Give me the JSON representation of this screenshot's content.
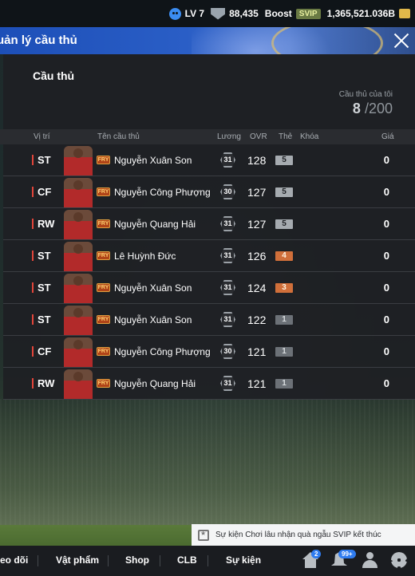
{
  "topbar": {
    "level": "LV 7",
    "points": "88,435",
    "boost_label": "Boost",
    "svip_label": "SVIP",
    "coins": "1,365,521.036B"
  },
  "titlebar": {
    "title": "uản lý cầu thủ"
  },
  "section_title": "Cầu thủ",
  "player_count": {
    "label": "Cầu thủ của tôi",
    "current": "8",
    "total": "/200"
  },
  "table": {
    "headers": {
      "position": "Vị trí",
      "name": "Tên cầu thủ",
      "wage": "Lương",
      "ovr": "OVR",
      "upgrade": "Thẻ",
      "lock": "Khóa",
      "price": "Giá"
    },
    "rows": [
      {
        "pos": "ST",
        "season": "FRY",
        "name": "Nguyễn Xuân Son",
        "wage": "31",
        "ovr": "128",
        "upgrade": "5",
        "price": "0"
      },
      {
        "pos": "CF",
        "season": "FRY",
        "name": "Nguyễn Công Phượng",
        "wage": "30",
        "ovr": "127",
        "upgrade": "5",
        "price": "0"
      },
      {
        "pos": "RW",
        "season": "FRY",
        "name": "Nguyễn Quang Hải",
        "wage": "31",
        "ovr": "127",
        "upgrade": "5",
        "price": "0"
      },
      {
        "pos": "ST",
        "season": "FRY",
        "name": "Lê Huỳnh Đức",
        "wage": "31",
        "ovr": "126",
        "upgrade": "4",
        "price": "0"
      },
      {
        "pos": "ST",
        "season": "FRY",
        "name": "Nguyễn Xuân Son",
        "wage": "31",
        "ovr": "124",
        "upgrade": "3",
        "price": "0"
      },
      {
        "pos": "ST",
        "season": "FRY",
        "name": "Nguyễn Xuân Son",
        "wage": "31",
        "ovr": "122",
        "upgrade": "1",
        "price": "0"
      },
      {
        "pos": "CF",
        "season": "FRY",
        "name": "Nguyễn Công Phượng",
        "wage": "30",
        "ovr": "121",
        "upgrade": "1",
        "price": "0"
      },
      {
        "pos": "RW",
        "season": "FRY",
        "name": "Nguyễn Quang Hải",
        "wage": "31",
        "ovr": "121",
        "upgrade": "1",
        "price": "0"
      }
    ]
  },
  "event_banner": "Sự kiện Chơi lâu nhận quà ngẫu SVIP kết thúc",
  "bottomnav": {
    "items": [
      "eo dõi",
      "Vật phẩm",
      "Shop",
      "CLB",
      "Sự kiện"
    ],
    "home_badge": "2",
    "bell_badge": "99+"
  }
}
